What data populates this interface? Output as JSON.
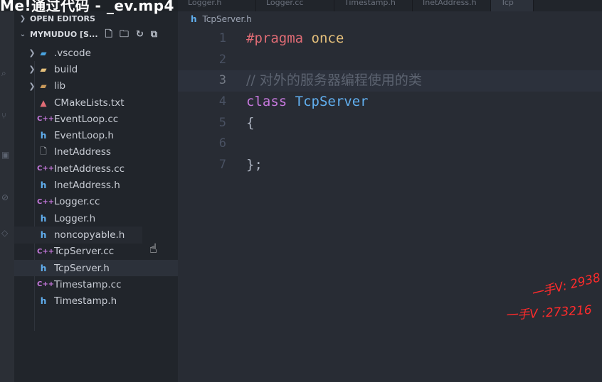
{
  "overlay_title": "Me!通过代码 - _ev.mp4",
  "tabs": [
    "Logger.h",
    "Logger.cc",
    "Timestamp.h",
    "InetAddress.h",
    "Tcp"
  ],
  "sidebar": {
    "open_editors_label": "OPEN EDITORS",
    "project_label": "MYMUDUO [S...",
    "items": [
      {
        "label": ".vscode",
        "kind": "folder",
        "icon": "vscode-folder-icon"
      },
      {
        "label": "build",
        "kind": "folder",
        "icon": "folder-icon"
      },
      {
        "label": "lib",
        "kind": "folder",
        "icon": "lib-folder-icon"
      },
      {
        "label": "CMakeLists.txt",
        "kind": "file",
        "icon": "cmake-icon"
      },
      {
        "label": "EventLoop.cc",
        "kind": "file",
        "icon": "cpp-icon"
      },
      {
        "label": "EventLoop.h",
        "kind": "file",
        "icon": "header-icon"
      },
      {
        "label": "InetAddress",
        "kind": "file",
        "icon": "file-icon"
      },
      {
        "label": "InetAddress.cc",
        "kind": "file",
        "icon": "cpp-icon"
      },
      {
        "label": "InetAddress.h",
        "kind": "file",
        "icon": "header-icon"
      },
      {
        "label": "Logger.cc",
        "kind": "file",
        "icon": "cpp-icon"
      },
      {
        "label": "Logger.h",
        "kind": "file",
        "icon": "header-icon"
      },
      {
        "label": "noncopyable.h",
        "kind": "file",
        "icon": "header-icon"
      },
      {
        "label": "TcpServer.cc",
        "kind": "file",
        "icon": "cpp-icon"
      },
      {
        "label": "TcpServer.h",
        "kind": "file",
        "icon": "header-icon"
      },
      {
        "label": "Timestamp.cc",
        "kind": "file",
        "icon": "cpp-icon"
      },
      {
        "label": "Timestamp.h",
        "kind": "file",
        "icon": "header-icon"
      }
    ]
  },
  "editor": {
    "breadcrumb_file": "TcpServer.h",
    "line_numbers": [
      "1",
      "2",
      "3",
      "4",
      "5",
      "6",
      "7"
    ],
    "code": {
      "l1_pragma": "#pragma",
      "l1_once": "once",
      "l3_comment": "// 对外的服务器编程使用的类",
      "l4_class": "class",
      "l4_name": "TcpServer",
      "l5_brace": "{",
      "l7_close": "};"
    }
  },
  "watermarks": [
    "一手V: 2938",
    "一手V :273216"
  ],
  "colors": {
    "sidebar_bg": "#21252b",
    "editor_bg": "#282c34",
    "keyword_purple": "#c678dd",
    "type_blue": "#61afef",
    "preprocessor_red": "#e06c75",
    "watermark_red": "#ff2b2b"
  }
}
